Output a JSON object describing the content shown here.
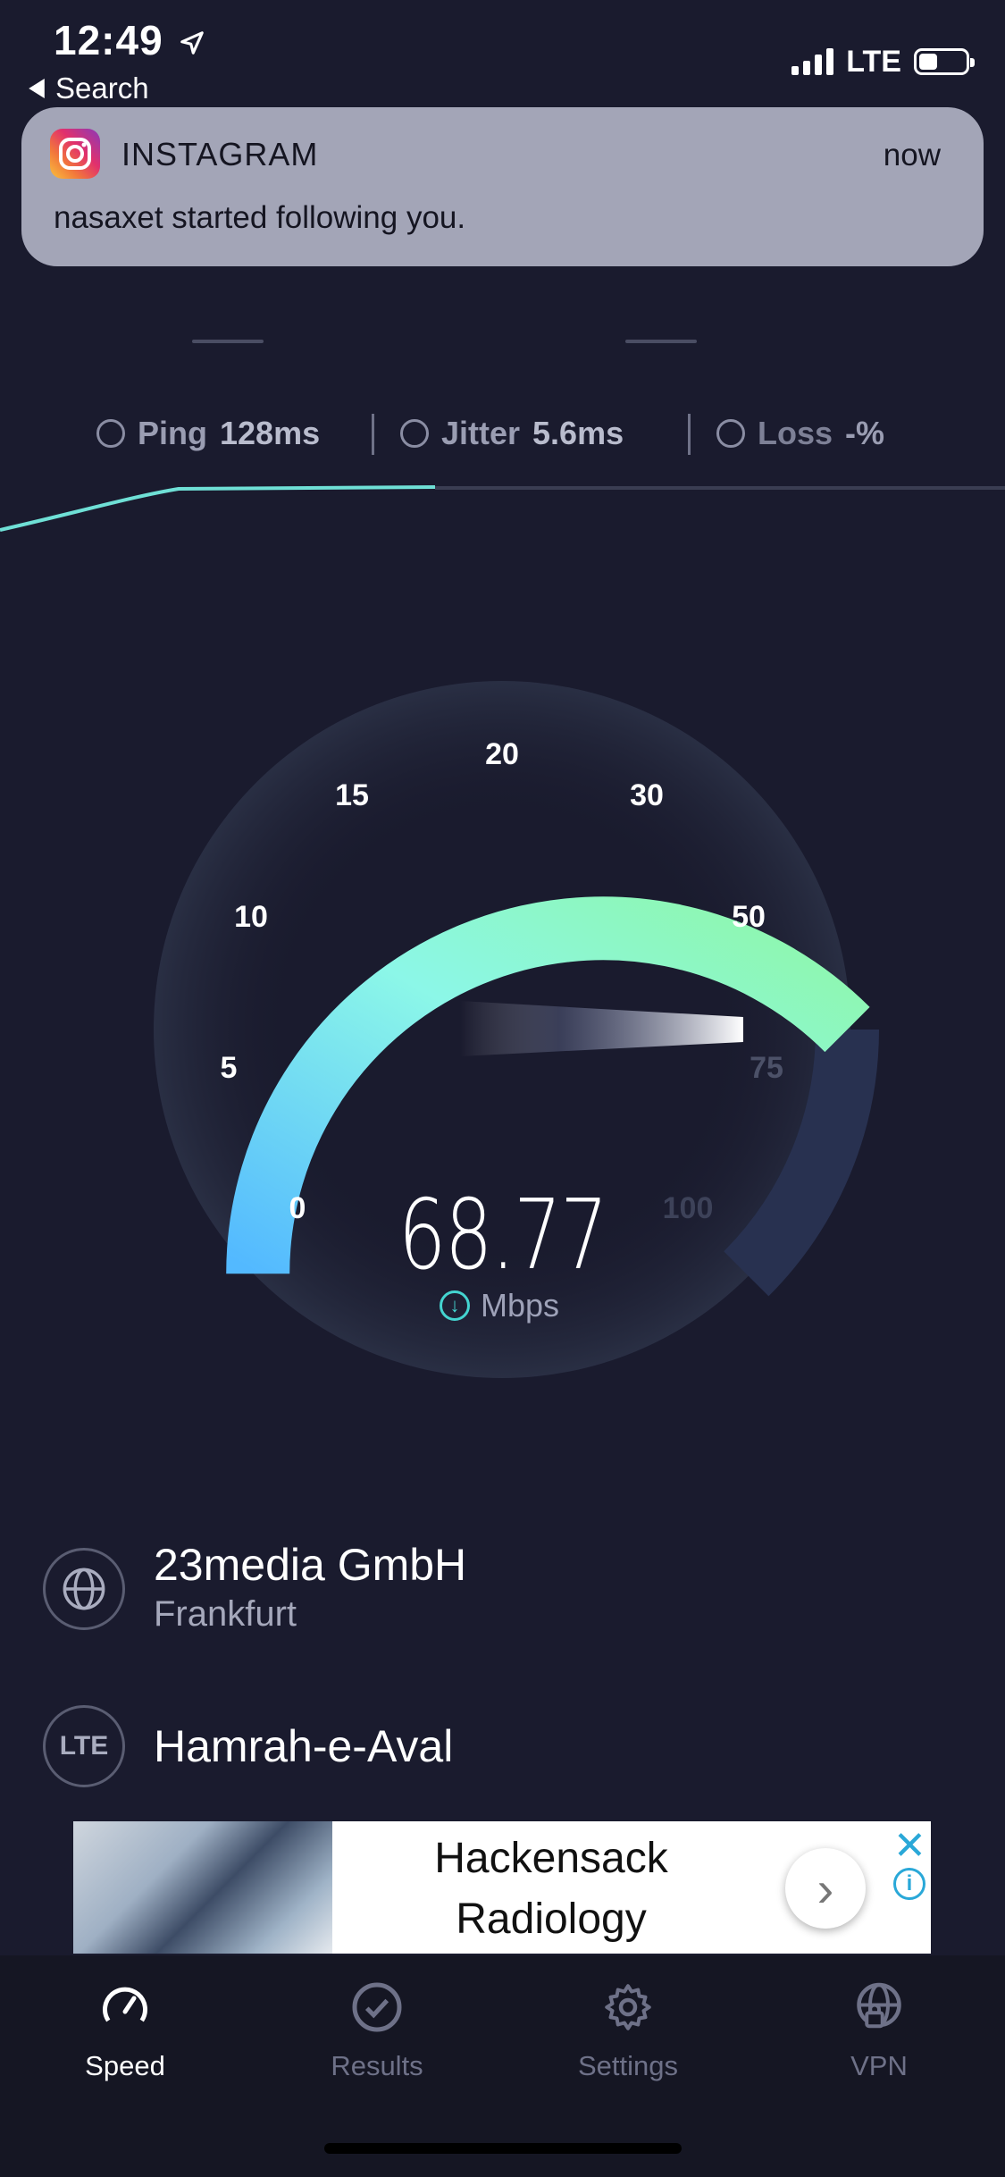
{
  "status": {
    "time": "12:49",
    "network": "LTE",
    "back_label": "Search"
  },
  "notification": {
    "app": "INSTAGRAM",
    "time": "now",
    "message": "nasaxet started following you."
  },
  "metrics": {
    "ping_label": "Ping",
    "ping_value": "128",
    "ping_unit": "ms",
    "jitter_label": "Jitter",
    "jitter_value": "5.6",
    "jitter_unit": "ms",
    "loss_label": "Loss",
    "loss_value": "-",
    "loss_unit": "%"
  },
  "gauge": {
    "ticks": [
      "0",
      "5",
      "10",
      "15",
      "20",
      "30",
      "50",
      "75",
      "100"
    ],
    "value": "68.77",
    "unit": "Mbps",
    "gradient_colors": [
      "#53b9ff",
      "#8cf7e8",
      "#8ef7a8"
    ]
  },
  "server": {
    "name": "23media GmbH",
    "city": "Frankfurt",
    "icon": "globe-icon"
  },
  "carrier": {
    "badge": "LTE",
    "name": "Hamrah-e-Aval"
  },
  "ad": {
    "line1": "Hackensack",
    "line2": "Radiology"
  },
  "tabs": [
    {
      "label": "Speed",
      "icon": "speedometer-icon",
      "active": true
    },
    {
      "label": "Results",
      "icon": "checkmark-circle-icon",
      "active": false
    },
    {
      "label": "Settings",
      "icon": "gear-icon",
      "active": false
    },
    {
      "label": "VPN",
      "icon": "globe-lock-icon",
      "active": false
    }
  ]
}
